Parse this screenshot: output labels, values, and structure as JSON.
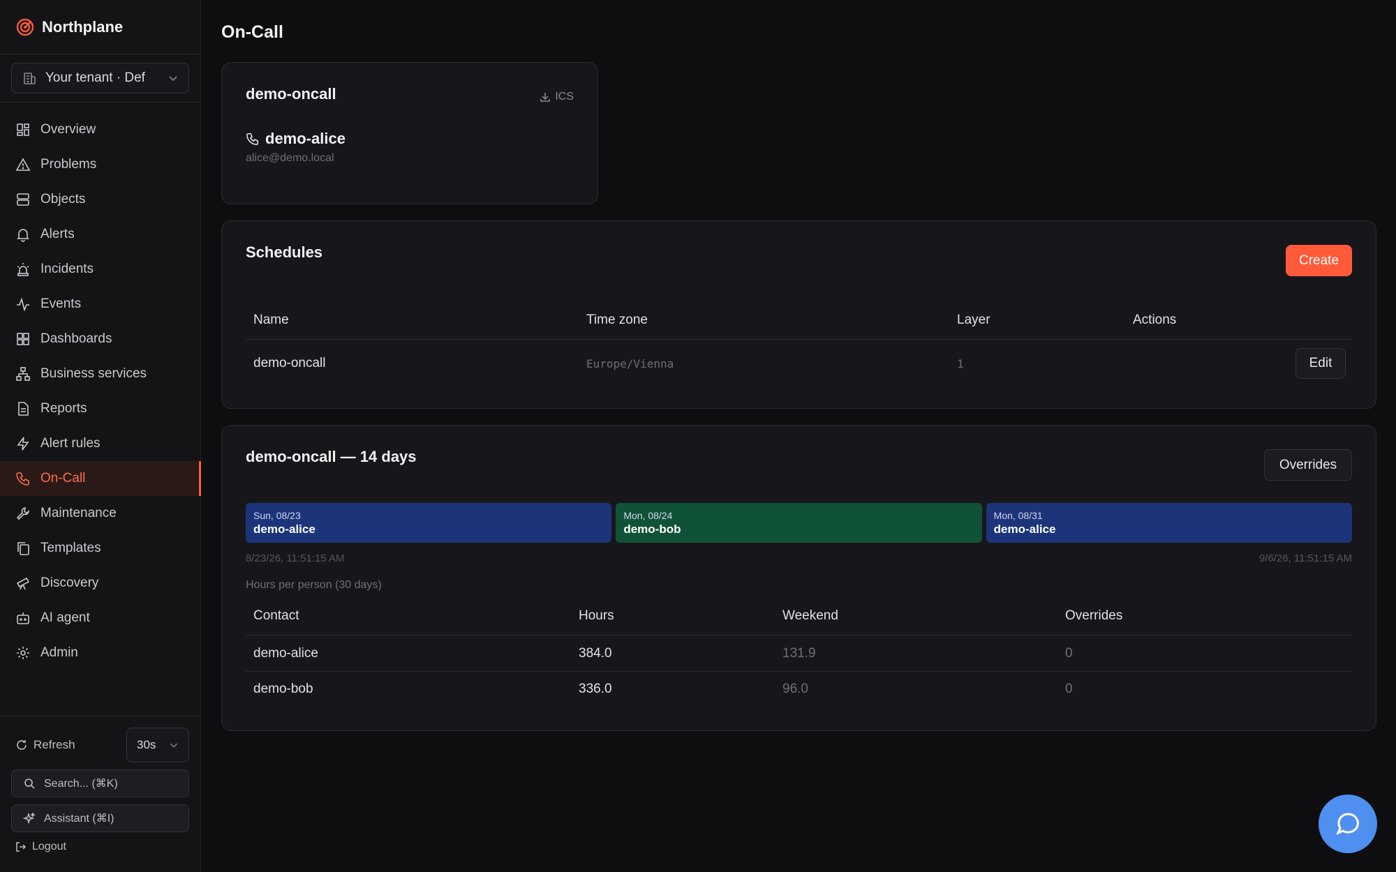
{
  "app": {
    "name": "Northplane"
  },
  "tenant": {
    "label": "Your tenant · Def"
  },
  "nav": [
    {
      "label": "Overview",
      "icon": "grid-icon"
    },
    {
      "label": "Problems",
      "icon": "warning-icon"
    },
    {
      "label": "Objects",
      "icon": "server-icon"
    },
    {
      "label": "Alerts",
      "icon": "bell-icon"
    },
    {
      "label": "Incidents",
      "icon": "siren-icon"
    },
    {
      "label": "Events",
      "icon": "activity-icon"
    },
    {
      "label": "Dashboards",
      "icon": "dashboard-icon"
    },
    {
      "label": "Business services",
      "icon": "network-icon"
    },
    {
      "label": "Reports",
      "icon": "file-icon"
    },
    {
      "label": "Alert rules",
      "icon": "zap-icon"
    },
    {
      "label": "On-Call",
      "icon": "phone-icon",
      "active": true
    },
    {
      "label": "Maintenance",
      "icon": "wrench-icon"
    },
    {
      "label": "Templates",
      "icon": "copy-icon"
    },
    {
      "label": "Discovery",
      "icon": "telescope-icon"
    },
    {
      "label": "AI agent",
      "icon": "bot-icon"
    },
    {
      "label": "Admin",
      "icon": "gear-icon"
    }
  ],
  "sidebar_bottom": {
    "refresh_label": "Refresh",
    "interval": "30s",
    "search_label": "Search... (⌘K)",
    "assistant_label": "Assistant (⌘I)",
    "logout_label": "Logout"
  },
  "page": {
    "title": "On-Call"
  },
  "oncall_card": {
    "title": "demo-oncall",
    "ics_label": "ICS",
    "person": "demo-alice",
    "email": "alice@demo.local"
  },
  "schedules": {
    "title": "Schedules",
    "create_label": "Create",
    "columns": [
      "Name",
      "Time zone",
      "Layer",
      "Actions"
    ],
    "rows": [
      {
        "name": "demo-oncall",
        "tz": "Europe/Vienna",
        "layer": "1",
        "action": "Edit"
      }
    ]
  },
  "calendar": {
    "title": "demo-oncall — 14 days",
    "overrides_label": "Overrides",
    "segments": [
      {
        "date": "Sun, 08/23",
        "name": "demo-alice",
        "color": "#1c347a"
      },
      {
        "date": "Mon, 08/24",
        "name": "demo-bob",
        "color": "#0f5238"
      },
      {
        "date": "Mon, 08/31",
        "name": "demo-alice",
        "color": "#1c347a"
      }
    ],
    "start_ts": "8/23/26, 11:51:15 AM",
    "end_ts": "9/6/26, 11:51:15 AM",
    "hours_title": "Hours per person (30 days)",
    "columns": [
      "Contact",
      "Hours",
      "Weekend",
      "Overrides"
    ],
    "rows": [
      {
        "contact": "demo-alice",
        "hours": "384.0",
        "weekend": "131.9",
        "overrides": "0"
      },
      {
        "contact": "demo-bob",
        "hours": "336.0",
        "weekend": "96.0",
        "overrides": "0"
      }
    ]
  },
  "colors": {
    "accent": "#ff5a3a",
    "fab": "#4f8ff0"
  }
}
